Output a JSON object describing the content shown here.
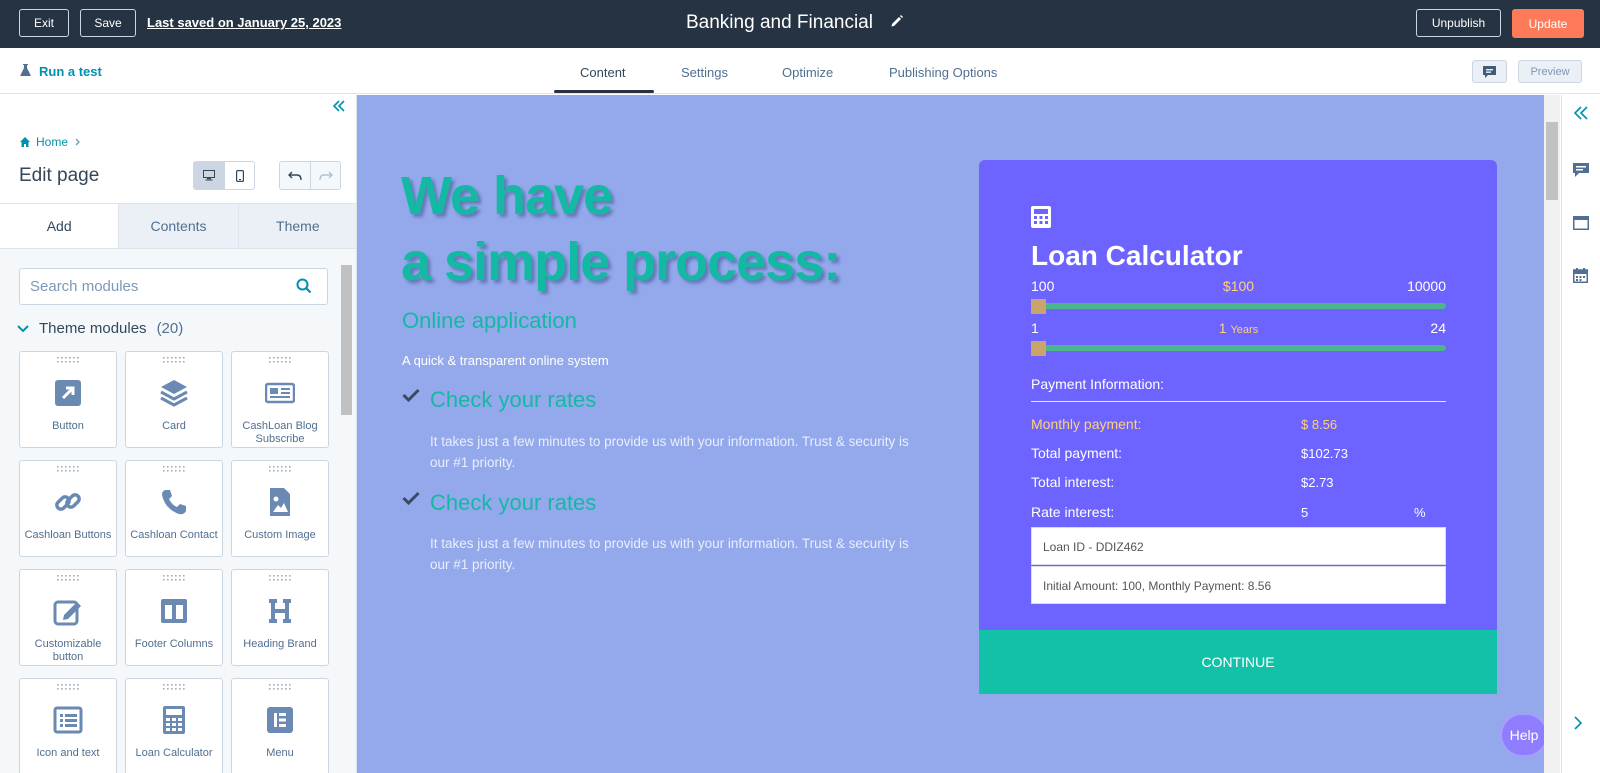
{
  "topbar": {
    "exit_label": "Exit",
    "save_label": "Save",
    "last_saved": "Last saved on January 25, 2023",
    "page_title": "Banking and Financial",
    "unpublish_label": "Unpublish",
    "update_label": "Update"
  },
  "subnav": {
    "run_test": "Run a test",
    "tabs": [
      "Content",
      "Settings",
      "Optimize",
      "Publishing Options"
    ],
    "active_tab": "Content",
    "preview_label": "Preview"
  },
  "sidebar": {
    "breadcrumb": "Home",
    "title": "Edit page",
    "tabs": [
      "Add",
      "Contents",
      "Theme"
    ],
    "search_placeholder": "Search modules",
    "section_title": "Theme modules",
    "section_count": "(20)",
    "modules": [
      {
        "label": "Button",
        "icon": "external-link-icon"
      },
      {
        "label": "Card",
        "icon": "layers-icon"
      },
      {
        "label": "CashLoan Blog Subscribe",
        "icon": "newspaper-icon"
      },
      {
        "label": "Cashloan Buttons",
        "icon": "link-icon"
      },
      {
        "label": "Cashloan Contact",
        "icon": "phone-icon"
      },
      {
        "label": "Custom Image",
        "icon": "image-file-icon"
      },
      {
        "label": "Customizable button",
        "icon": "edit-icon"
      },
      {
        "label": "Footer Columns",
        "icon": "columns-icon"
      },
      {
        "label": "Heading Brand",
        "icon": "heading-icon"
      },
      {
        "label": "Icon and text",
        "icon": "list-icon"
      },
      {
        "label": "Loan Calculator",
        "icon": "calculator-icon"
      },
      {
        "label": "Menu",
        "icon": "elementor-icon"
      }
    ]
  },
  "canvas": {
    "hero_line1": "We have",
    "hero_line2": "a simple process:",
    "subtitle": "Online application",
    "subtitle_desc": "A quick & transparent online system",
    "checks": [
      {
        "title": "Check your rates",
        "desc": "It takes just a few minutes to provide us with your information. Trust & security is our #1 priority."
      },
      {
        "title": "Check your rates",
        "desc": "It takes just a few minutes to provide us with your information. Trust & security is our #1 priority."
      }
    ],
    "calculator": {
      "title": "Loan Calculator",
      "amount_min": "100",
      "amount_value": "$100",
      "amount_max": "10000",
      "amount_fraction": 0.0,
      "term_min": "1",
      "term_value": "1",
      "term_unit": "Years",
      "term_max": "24",
      "term_fraction": 0.0,
      "payment_header": "Payment Information:",
      "monthly_label": "Monthly payment:",
      "monthly_value": "$ 8.56",
      "total_label": "Total payment:",
      "total_value": "$102.73",
      "interest_label": "Total interest:",
      "interest_value": "$2.73",
      "rate_label": "Rate interest:",
      "rate_value": "5",
      "rate_unit": "%",
      "loan_id": "Loan  ID -  DDIZ462",
      "summary": "Initial Amount: 100,  Monthly  Payment: 8.56",
      "continue_label": "CONTINUE"
    },
    "help_label": "Help"
  },
  "colors": {
    "topbar": "#253342",
    "accent_orange": "#ff7a59",
    "canvas_bg": "#94a9ec",
    "teal": "#13b9a2",
    "calc_bg": "#6d63ff",
    "continue_bg": "#13c1a8"
  }
}
